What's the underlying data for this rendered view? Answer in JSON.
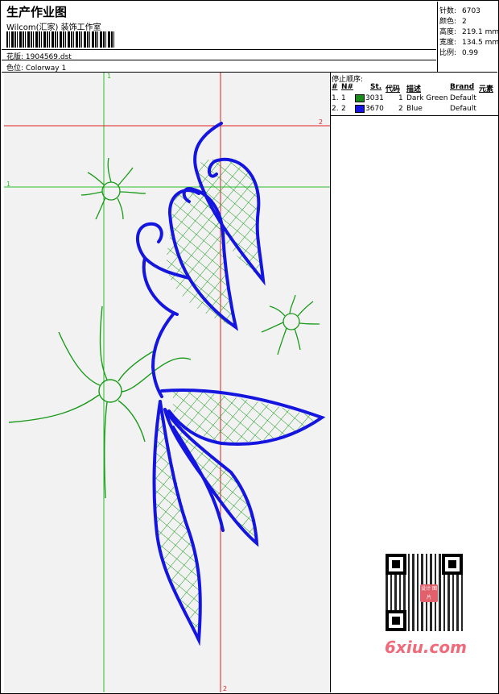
{
  "header": {
    "title": "生产作业图",
    "subtitle": "Wilcom(汇家) 装饰工作室",
    "design_label": "花版:",
    "design_value": "1904569.dst",
    "colorway_label": "色位:",
    "colorway_value": "Colorway 1"
  },
  "stats": [
    {
      "label": "针数:",
      "value": "6703"
    },
    {
      "label": "颜色:",
      "value": "2"
    },
    {
      "label": "高度:",
      "value": "219.1 mm"
    },
    {
      "label": "宽度:",
      "value": "134.5 mm"
    },
    {
      "label": "比例:",
      "value": "0.99"
    }
  ],
  "stop_sequence": {
    "label": "停止顺序:",
    "headers": [
      "#",
      "N#",
      "St.",
      "代码",
      "描述",
      "Brand",
      "元素"
    ],
    "rows": [
      {
        "num": "1.",
        "n": "1",
        "st": "3031",
        "code": "1",
        "desc": "Dark Green",
        "brand": "Default",
        "color": "#1a8a1a"
      },
      {
        "num": "2.",
        "n": "2",
        "st": "3670",
        "code": "2",
        "desc": "Blue",
        "brand": "Default",
        "color": "#1515e0"
      }
    ]
  },
  "guides": {
    "v1": "1",
    "v2": "2",
    "h1": "1",
    "h2": "2",
    "green": "#2bc02b",
    "red": "#e02020"
  },
  "colors": {
    "green_thread": "#1a9a1a",
    "blue_thread": "#1515e0"
  },
  "watermark": {
    "text": "6xiu.com",
    "seal": "设计 图片"
  }
}
